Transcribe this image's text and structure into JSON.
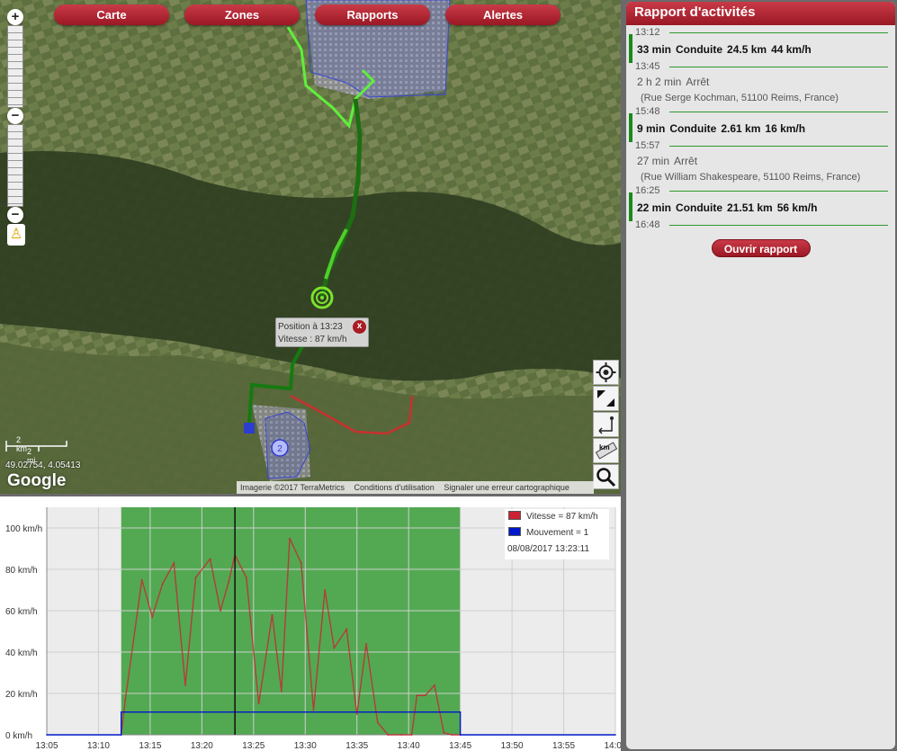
{
  "nav": {
    "tabs": [
      {
        "label": "Carte"
      },
      {
        "label": "Zones"
      },
      {
        "label": "Rapports"
      },
      {
        "label": "Alertes"
      }
    ]
  },
  "map": {
    "zoom_in": "+",
    "zoom_out": "−",
    "zoom_mid": "−",
    "popup": {
      "line1": "Position à 13:23",
      "line2": "Vitesse : 87 km/h",
      "close": "x"
    },
    "marker_label": "2",
    "scale_km": "2 km",
    "scale_mi": "2 mi",
    "coords": "49.02754, 4.05413",
    "google": "Google",
    "attribution": [
      "Imagerie ©2017 TerraMetrics",
      "Conditions d'utilisation",
      "Signaler une erreur cartographique"
    ],
    "tools": [
      "locate-icon",
      "fullscreen-icon",
      "route-icon",
      "measure-km-icon",
      "search-icon"
    ],
    "tool_km_label": "km"
  },
  "report": {
    "title": "Rapport d'activités",
    "entries": [
      {
        "kind": "time",
        "text": "13:12"
      },
      {
        "kind": "drive",
        "duration": "33 min",
        "label": "Conduite",
        "distance": "24.5 km",
        "speed": "44 km/h"
      },
      {
        "kind": "time",
        "text": "13:45"
      },
      {
        "kind": "stop",
        "duration": "2 h 2 min",
        "label": "Arrêt",
        "address": "(Rue Serge Kochman, 51100 Reims, France)"
      },
      {
        "kind": "time",
        "text": "15:48"
      },
      {
        "kind": "drive",
        "duration": "9 min",
        "label": "Conduite",
        "distance": "2.61 km",
        "speed": "16 km/h"
      },
      {
        "kind": "time",
        "text": "15:57"
      },
      {
        "kind": "stop",
        "duration": "27 min",
        "label": "Arrêt",
        "address": "(Rue William Shakespeare, 51100 Reims, France)"
      },
      {
        "kind": "time",
        "text": "16:25"
      },
      {
        "kind": "drive",
        "duration": "22 min",
        "label": "Conduite",
        "distance": "21.51 km",
        "speed": "56 km/h"
      },
      {
        "kind": "time",
        "text": "16:48"
      }
    ],
    "open_button": "Ouvrir rapport"
  },
  "chart_data": {
    "type": "line",
    "title": "",
    "xlabel": "",
    "ylabel": "",
    "x_ticks": [
      "13:05",
      "13:10",
      "13:15",
      "13:20",
      "13:25",
      "13:30",
      "13:35",
      "13:40",
      "13:45",
      "13:50",
      "13:55",
      "14:00"
    ],
    "y_ticks": [
      "0 km/h",
      "20 km/h",
      "40 km/h",
      "60 km/h",
      "80 km/h",
      "100 km/h"
    ],
    "xlim_min": [
      5,
      60
    ],
    "ylim": [
      0,
      110
    ],
    "shaded_range_min": [
      12.2,
      45
    ],
    "cursor_min": 23.2,
    "series": [
      {
        "name": "Vitesse = 87 km/h",
        "color": "#cc2233",
        "x": [
          12.2,
          12.6,
          14.2,
          15.2,
          16.2,
          17.3,
          18.4,
          19.4,
          20.8,
          21.8,
          22.6,
          23.2,
          24.3,
          25.5,
          26.8,
          27.7,
          28.5,
          29.6,
          30.8,
          31.9,
          32.8,
          34.0,
          35.0,
          35.9,
          37.0,
          38.0,
          39.3,
          40.3,
          40.8,
          41.3,
          41.6,
          42.5,
          43.4,
          44.2,
          45.0
        ],
        "y": [
          0,
          17,
          75,
          57,
          73,
          83,
          24,
          76,
          85,
          60,
          74,
          87,
          76,
          15,
          58,
          21,
          95,
          83,
          12,
          70,
          42,
          51,
          10,
          44,
          6,
          0,
          0,
          0,
          19,
          19,
          19,
          24,
          1,
          0,
          0
        ]
      },
      {
        "name": "Mouvement = 1",
        "color": "#0018cc",
        "x": [
          5,
          12.2,
          12.2,
          45,
          45,
          60
        ],
        "y": [
          0,
          0,
          11,
          11,
          0,
          0
        ]
      }
    ],
    "legend": {
      "position": "top-right",
      "date": "08/08/2017 13:23:11"
    }
  }
}
